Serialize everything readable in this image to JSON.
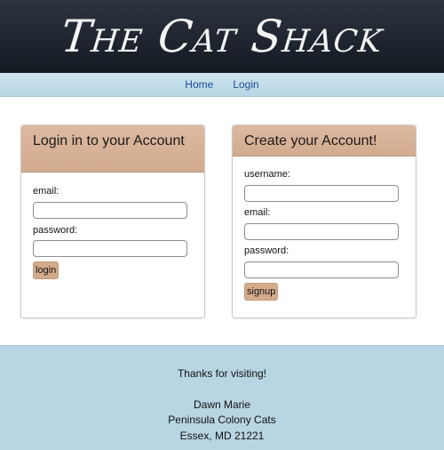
{
  "banner": {
    "title": "The Cat Shack"
  },
  "nav": {
    "home": "Home",
    "login": "Login"
  },
  "login_card": {
    "title": "Login in to your Account",
    "email_label": "email:",
    "email_value": "",
    "password_label": "password:",
    "password_value": "",
    "button": "login"
  },
  "signup_card": {
    "title": "Create your Account!",
    "username_label": "username:",
    "username_value": "",
    "email_label": "email:",
    "email_value": "",
    "password_label": "password:",
    "password_value": "",
    "button": "signup"
  },
  "footer": {
    "thanks": "Thanks for visiting!",
    "name": "Dawn Marie",
    "org": "Peninsula Colony Cats",
    "address": "Essex, MD 21221"
  },
  "colors": {
    "banner_bg": "#1e252f",
    "nav_bg": "#c4dfea",
    "card_header": "#d6b096",
    "button": "#d4ab8b",
    "footer_bg": "#b7d5e3",
    "link": "#1f4d9a"
  }
}
